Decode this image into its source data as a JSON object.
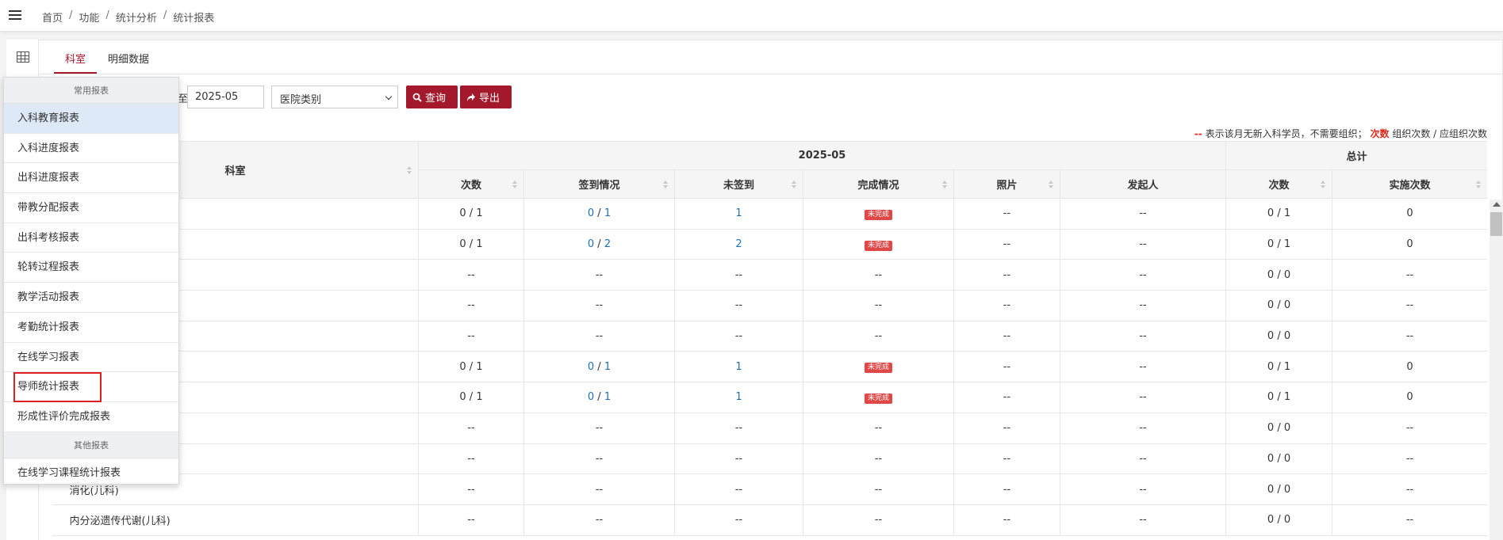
{
  "breadcrumb": [
    "首页",
    "功能",
    "统计分析",
    "统计报表"
  ],
  "tabs": [
    {
      "label": "科室",
      "active": true
    },
    {
      "label": "明细数据",
      "active": false
    }
  ],
  "filters": {
    "to_label": "至",
    "end_date": "2025-05",
    "hospital_type": "医院类别",
    "query_label": "查询",
    "export_label": "导出"
  },
  "legend": {
    "dash": "--",
    "dash_text": "表示该月无新入科学员，不需要组织；",
    "key": "次数",
    "key_text": "组织次数 / 应组织次数"
  },
  "table": {
    "headers": {
      "dept": "科室",
      "month": "2025-05",
      "total": "总计",
      "sub": [
        "次数",
        "签到情况",
        "未签到",
        "完成情况",
        "照片",
        "发起人"
      ],
      "total_sub": [
        "次数",
        "实施次数"
      ]
    },
    "rows": [
      {
        "name": "",
        "count": "0 / 1",
        "sign_a": "0",
        "sign_b": "1",
        "unsigned": "1",
        "status": "未完成",
        "photo": "--",
        "initiator": "--",
        "total": "0 / 1",
        "done": "0"
      },
      {
        "name": "",
        "count": "0 / 1",
        "sign_a": "0",
        "sign_b": "2",
        "unsigned": "2",
        "status": "未完成",
        "photo": "--",
        "initiator": "--",
        "total": "0 / 1",
        "done": "0"
      },
      {
        "name": "",
        "count": "--",
        "sign": "--",
        "unsigned": "--",
        "status": "--",
        "photo": "--",
        "initiator": "--",
        "total": "0 / 0",
        "done": "--"
      },
      {
        "name": "",
        "count": "--",
        "sign": "--",
        "unsigned": "--",
        "status": "--",
        "photo": "--",
        "initiator": "--",
        "total": "0 / 0",
        "done": "--"
      },
      {
        "name": "",
        "count": "--",
        "sign": "--",
        "unsigned": "--",
        "status": "--",
        "photo": "--",
        "initiator": "--",
        "total": "0 / 0",
        "done": "--"
      },
      {
        "name": "",
        "count": "0 / 1",
        "sign_a": "0",
        "sign_b": "1",
        "unsigned": "1",
        "status": "未完成",
        "photo": "--",
        "initiator": "--",
        "total": "0 / 1",
        "done": "0"
      },
      {
        "name": "",
        "count": "0 / 1",
        "sign_a": "0",
        "sign_b": "1",
        "unsigned": "1",
        "status": "未完成",
        "photo": "--",
        "initiator": "--",
        "total": "0 / 1",
        "done": "0"
      },
      {
        "name": "",
        "count": "--",
        "sign": "--",
        "unsigned": "--",
        "status": "--",
        "photo": "--",
        "initiator": "--",
        "total": "0 / 0",
        "done": "--"
      },
      {
        "name": "",
        "count": "--",
        "sign": "--",
        "unsigned": "--",
        "status": "--",
        "photo": "--",
        "initiator": "--",
        "total": "0 / 0",
        "done": "--"
      },
      {
        "name": "消化(儿科)",
        "count": "--",
        "sign": "--",
        "unsigned": "--",
        "status": "--",
        "photo": "--",
        "initiator": "--",
        "total": "0 / 0",
        "done": "--"
      },
      {
        "name": "内分泌遗传代谢(儿科)",
        "count": "--",
        "sign": "--",
        "unsigned": "--",
        "status": "--",
        "photo": "--",
        "initiator": "--",
        "total": "0 / 0",
        "done": "--"
      }
    ]
  },
  "menu": {
    "group1": "常用报表",
    "items": [
      "入科教育报表",
      "入科进度报表",
      "出科进度报表",
      "带教分配报表",
      "出科考核报表",
      "轮转过程报表",
      "教学活动报表",
      "考勤统计报表",
      "在线学习报表",
      "导师统计报表",
      "形成性评价完成报表"
    ],
    "group2": "其他报表",
    "items2": [
      "在线学习课程统计报表"
    ]
  }
}
